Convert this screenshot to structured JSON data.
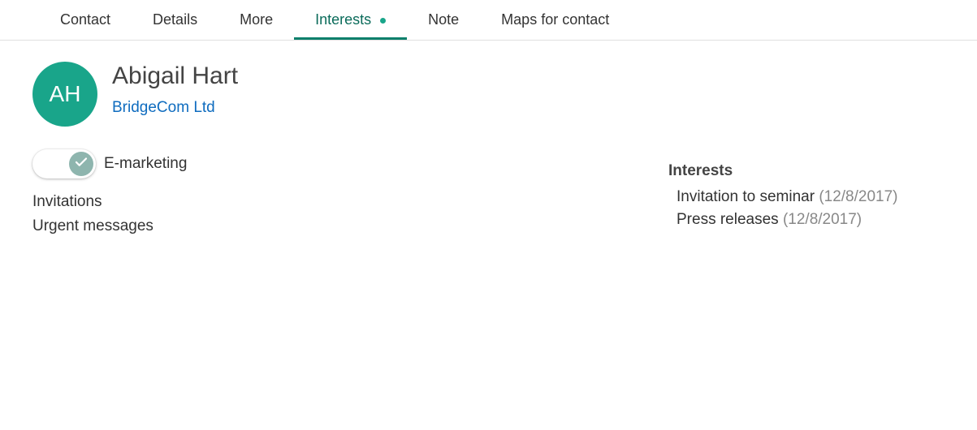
{
  "tabs": {
    "contact": "Contact",
    "details": "Details",
    "more": "More",
    "interests": "Interests",
    "note": "Note",
    "maps": "Maps for contact"
  },
  "avatar_initials": "AH",
  "contact_name": "Abigail Hart",
  "company_name": "BridgeCom Ltd",
  "subscriptions": {
    "emarketing": "E-marketing",
    "invitations": "Invitations",
    "urgent": "Urgent messages"
  },
  "interests_section": {
    "title": "Interests",
    "items": [
      {
        "label": "Invitation to seminar",
        "date": "(12/8/2017)"
      },
      {
        "label": "Press releases",
        "date": "(12/8/2017)"
      }
    ]
  }
}
